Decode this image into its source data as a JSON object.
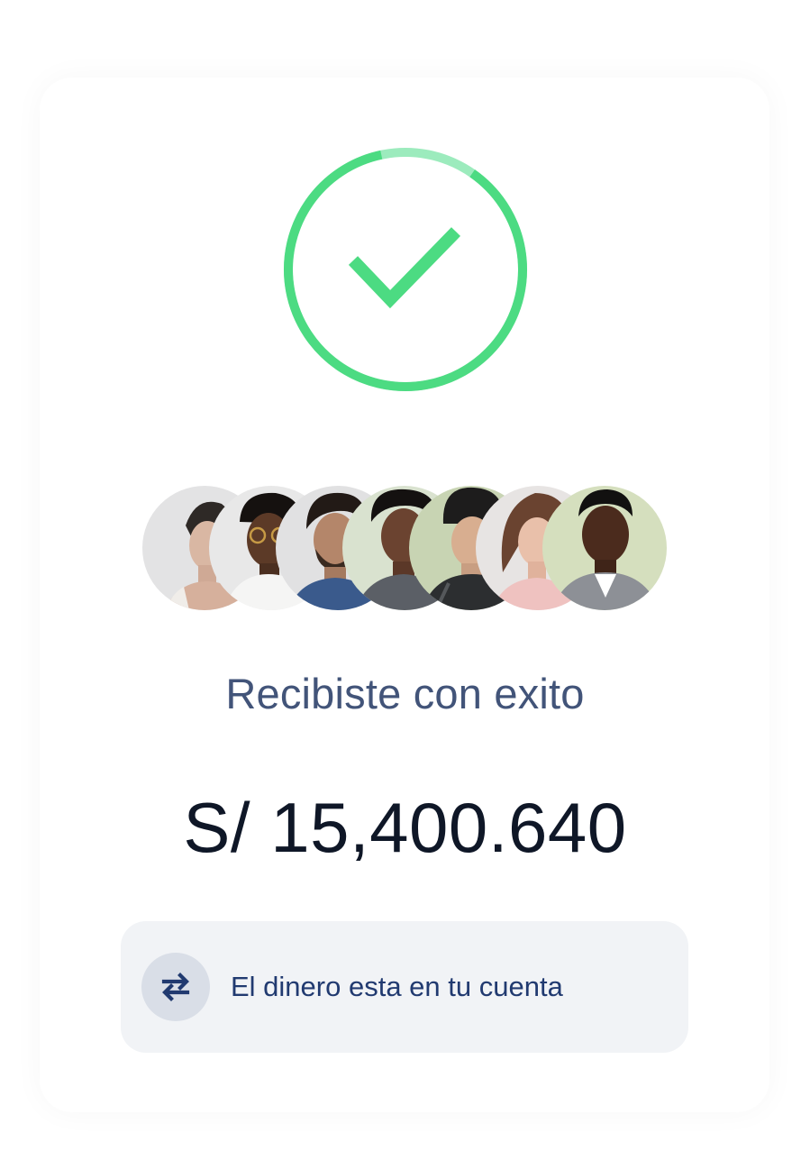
{
  "status": {
    "icon": "check-icon",
    "ring_progress": 0.87,
    "colors": {
      "ring": "#4cdb82",
      "ring_track": "#9cebbd",
      "check": "#4cdb82"
    }
  },
  "avatars": [
    {
      "name": "person-1"
    },
    {
      "name": "person-2"
    },
    {
      "name": "person-3"
    },
    {
      "name": "person-4"
    },
    {
      "name": "person-5"
    },
    {
      "name": "person-6"
    },
    {
      "name": "person-7"
    }
  ],
  "headline": "Recibiste con exito",
  "amount": "S/ 15,400.640",
  "notice": {
    "icon": "transfer-arrows-icon",
    "text": "El dinero esta en tu cuenta"
  },
  "colors": {
    "headline": "#425479",
    "amount": "#0f1727",
    "notice_bg": "#f1f3f6",
    "notice_text": "#213a70",
    "icon_bg": "#d9dee7"
  }
}
